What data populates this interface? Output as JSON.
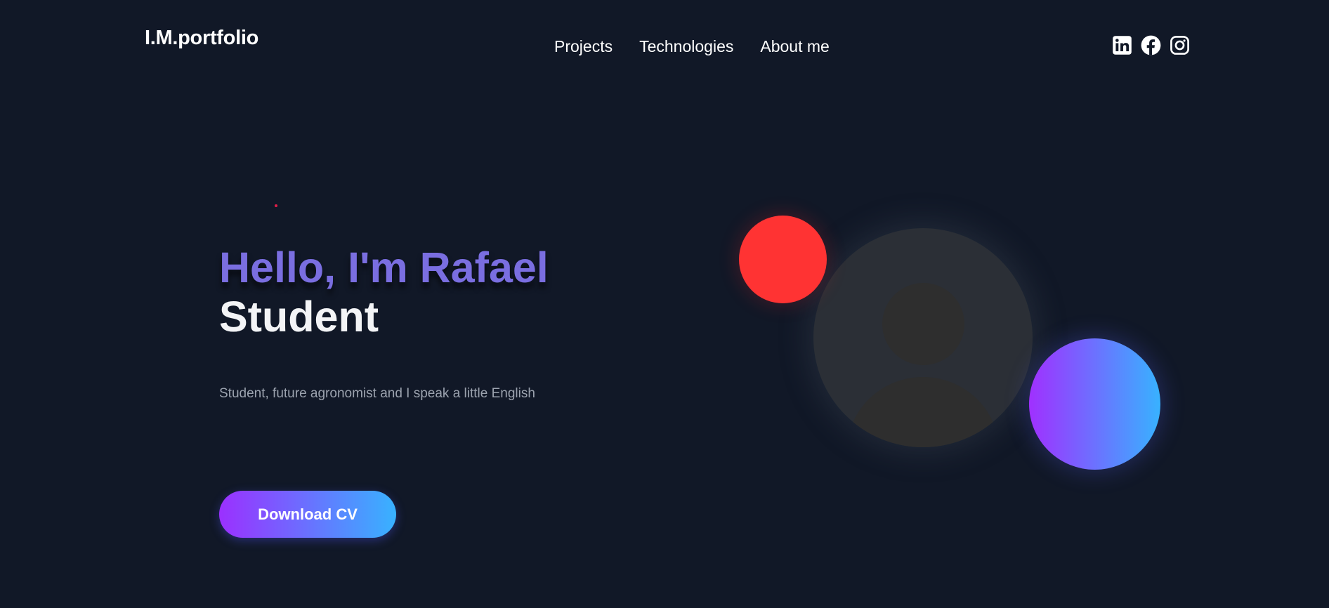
{
  "header": {
    "logo": "I.M.portfolio",
    "nav": [
      {
        "label": "Projects"
      },
      {
        "label": "Technologies"
      },
      {
        "label": "About me"
      }
    ],
    "social": [
      "linkedin-icon",
      "facebook-icon",
      "instagram-icon"
    ]
  },
  "hero": {
    "greeting": "Hello, I'm Rafael",
    "role": "Student",
    "description": "Student, future agronomist and I speak a little English",
    "cta_label": "Download CV"
  },
  "colors": {
    "background": "#111827",
    "greeting": "#7a6ee0",
    "accent_gradient_start": "#9b30ff",
    "accent_gradient_end": "#38b2ff",
    "red_circle": "#ff3333"
  }
}
